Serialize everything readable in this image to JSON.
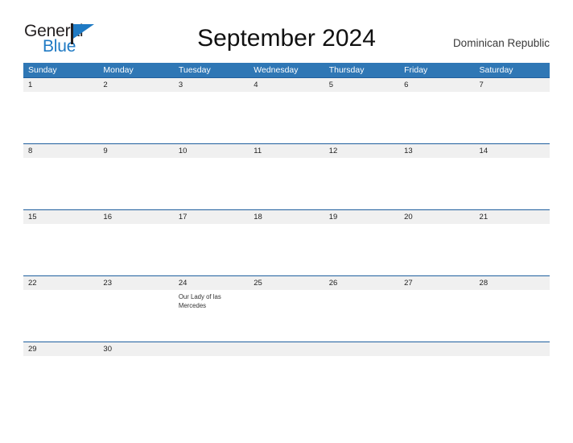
{
  "brand": {
    "name_top": "General",
    "name_bottom": "Blue",
    "mark_icon": "flag-triangle-icon",
    "accent_color": "#1f7ac4"
  },
  "header": {
    "title": "September 2024",
    "region": "Dominican Republic"
  },
  "calendar": {
    "header_bg": "#2f77b5",
    "date_band_bg": "#f0f0f0",
    "rule_color": "#1f5f9e",
    "day_names": [
      "Sunday",
      "Monday",
      "Tuesday",
      "Wednesday",
      "Thursday",
      "Friday",
      "Saturday"
    ],
    "weeks": [
      {
        "dates": [
          "1",
          "2",
          "3",
          "4",
          "5",
          "6",
          "7"
        ],
        "events": [
          "",
          "",
          "",
          "",
          "",
          "",
          ""
        ]
      },
      {
        "dates": [
          "8",
          "9",
          "10",
          "11",
          "12",
          "13",
          "14"
        ],
        "events": [
          "",
          "",
          "",
          "",
          "",
          "",
          ""
        ]
      },
      {
        "dates": [
          "15",
          "16",
          "17",
          "18",
          "19",
          "20",
          "21"
        ],
        "events": [
          "",
          "",
          "",
          "",
          "",
          "",
          ""
        ]
      },
      {
        "dates": [
          "22",
          "23",
          "24",
          "25",
          "26",
          "27",
          "28"
        ],
        "events": [
          "",
          "",
          "Our Lady of las Mercedes",
          "",
          "",
          "",
          ""
        ]
      },
      {
        "dates": [
          "29",
          "30",
          "",
          "",
          "",
          "",
          ""
        ],
        "events": [
          "",
          "",
          "",
          "",
          "",
          "",
          ""
        ]
      }
    ]
  }
}
